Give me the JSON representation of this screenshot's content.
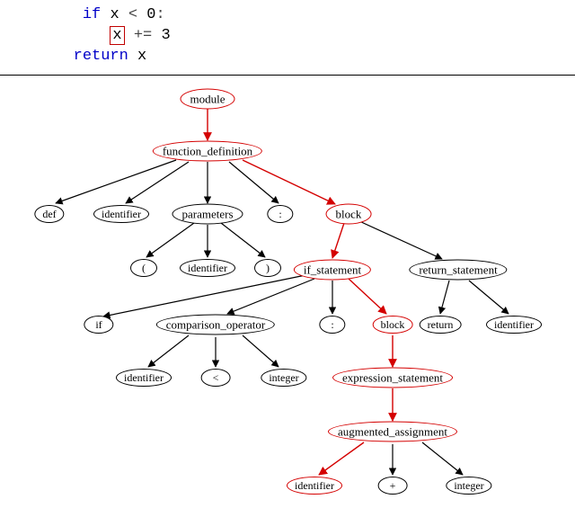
{
  "code": {
    "line1": {
      "indent": "         ",
      "if": "if",
      "x": "x",
      "lt": "<",
      "zero": "0",
      "colon": ":"
    },
    "line2": {
      "indent": "            ",
      "x_boxed": "x",
      "op": "+=",
      "three": "3"
    },
    "line3": {
      "indent": "        ",
      "return": "return",
      "x": "x"
    }
  },
  "nodes": {
    "module": "module",
    "function_definition": "function_definition",
    "def": "def",
    "identifier1": "identifier",
    "parameters": "parameters",
    "colon1": ":",
    "block1": "block",
    "lparen": "(",
    "identifier2": "identifier",
    "rparen": ")",
    "if_statement": "if_statement",
    "return_statement": "return_statement",
    "if": "if",
    "comparison_operator": "comparison_operator",
    "colon2": ":",
    "block2": "block",
    "return": "return",
    "identifier3": "identifier",
    "identifier4": "identifier",
    "lt": "<",
    "integer1": "integer",
    "expression_statement": "expression_statement",
    "augmented_assignment": "augmented_assignment",
    "identifier5": "identifier",
    "pluseq": "+",
    "integer2": "integer"
  }
}
